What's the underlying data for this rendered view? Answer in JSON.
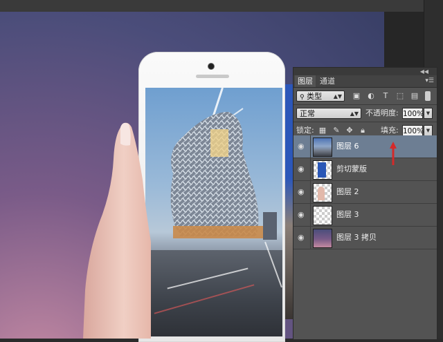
{
  "panel": {
    "tabs": [
      {
        "label": "图层"
      },
      {
        "label": "通道"
      }
    ],
    "filter": {
      "label": "类型"
    },
    "blend_mode": {
      "label": "正常"
    },
    "opacity": {
      "label": "不透明度:",
      "value": "100%"
    },
    "lock": {
      "label": "锁定:"
    },
    "fill": {
      "label": "填充:",
      "value": "100%"
    },
    "layers": [
      {
        "name": "图层 6",
        "selected": true
      },
      {
        "name": "剪切蒙版"
      },
      {
        "name": "图层 2"
      },
      {
        "name": "图层 3"
      },
      {
        "name": "图层 3 拷贝"
      }
    ]
  },
  "colors": {
    "selection": "#6d7e93",
    "annotation_arrow": "#d42a2a"
  },
  "icons": [
    "eye-icon",
    "search-icon",
    "image-filter-icon",
    "adjustment-filter-icon",
    "text-filter-icon",
    "shape-filter-icon",
    "smart-object-filter-icon",
    "lock-transparent-icon",
    "lock-paint-icon",
    "lock-move-icon",
    "lock-all-icon",
    "panel-menu-icon",
    "collapse-icon"
  ]
}
